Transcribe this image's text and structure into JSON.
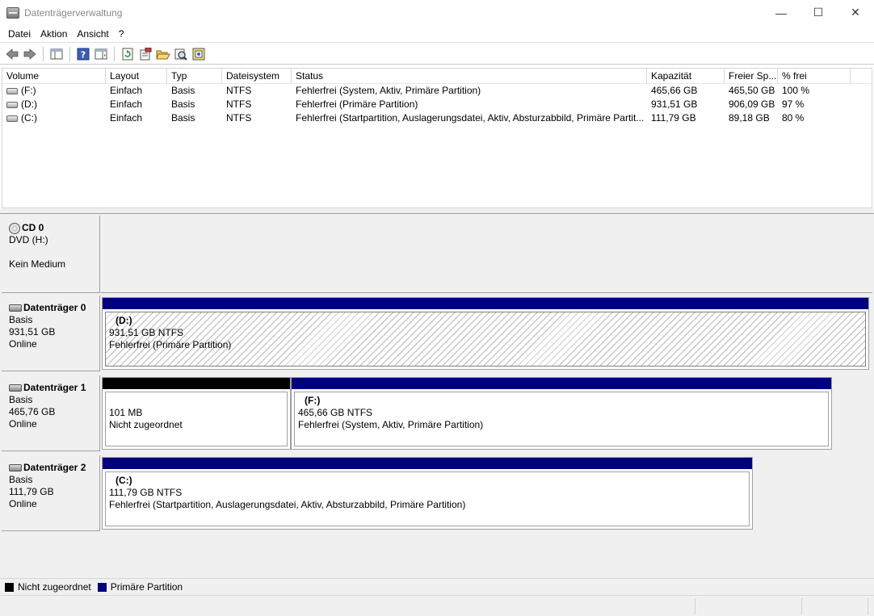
{
  "window": {
    "title": "Datenträgerverwaltung",
    "minimize": "—",
    "maximize": "☐",
    "close": "✕"
  },
  "menu": [
    "Datei",
    "Aktion",
    "Ansicht",
    "?"
  ],
  "toolbar_icons": [
    "back-arrow-icon",
    "forward-arrow-icon",
    "console-tree-icon",
    "help-icon",
    "action-pane-icon",
    "refresh-icon",
    "properties-icon",
    "open-folder-icon",
    "rescan-icon",
    "disk-settings-icon"
  ],
  "volumes": {
    "columns": [
      "Volume",
      "Layout",
      "Typ",
      "Dateisystem",
      "Status",
      "Kapazität",
      "Freier Sp...",
      "% frei"
    ],
    "rows": [
      [
        "(F:)",
        "Einfach",
        "Basis",
        "NTFS",
        "Fehlerfrei (System, Aktiv, Primäre Partition)",
        "465,66 GB",
        "465,50 GB",
        "100 %"
      ],
      [
        "(D:)",
        "Einfach",
        "Basis",
        "NTFS",
        "Fehlerfrei (Primäre Partition)",
        "931,51 GB",
        "906,09 GB",
        "97 %"
      ],
      [
        "(C:)",
        "Einfach",
        "Basis",
        "NTFS",
        "Fehlerfrei (Startpartition, Auslagerungsdatei, Aktiv, Absturzabbild, Primäre Partit...",
        "111,79 GB",
        "89,18 GB",
        "80 %"
      ]
    ]
  },
  "disks": {
    "cd0": {
      "name": "CD 0",
      "line1": "DVD (H:)",
      "line3": "Kein Medium"
    },
    "disk0": {
      "name": "Datenträger 0",
      "type": "Basis",
      "size": "931,51 GB",
      "state": "Online",
      "p1": {
        "name": "(D:)",
        "size": "931,51 GB NTFS",
        "status": "Fehlerfrei (Primäre Partition)"
      }
    },
    "disk1": {
      "name": "Datenträger 1",
      "type": "Basis",
      "size": "465,76 GB",
      "state": "Online",
      "p1": {
        "size": "101 MB",
        "status": "Nicht zugeordnet"
      },
      "p2": {
        "name": "(F:)",
        "size": "465,66 GB NTFS",
        "status": "Fehlerfrei (System, Aktiv, Primäre Partition)"
      }
    },
    "disk2": {
      "name": "Datenträger 2",
      "type": "Basis",
      "size": "111,79 GB",
      "state": "Online",
      "p1": {
        "name": "(C:)",
        "size": "111,79 GB NTFS",
        "status": "Fehlerfrei (Startpartition, Auslagerungsdatei, Aktiv, Absturzabbild, Primäre Partition)"
      }
    }
  },
  "legend": {
    "unallocated": "Nicht zugeordnet",
    "primary": "Primäre Partition"
  },
  "colors": {
    "primary": "#00007f",
    "unallocated": "#000000"
  }
}
